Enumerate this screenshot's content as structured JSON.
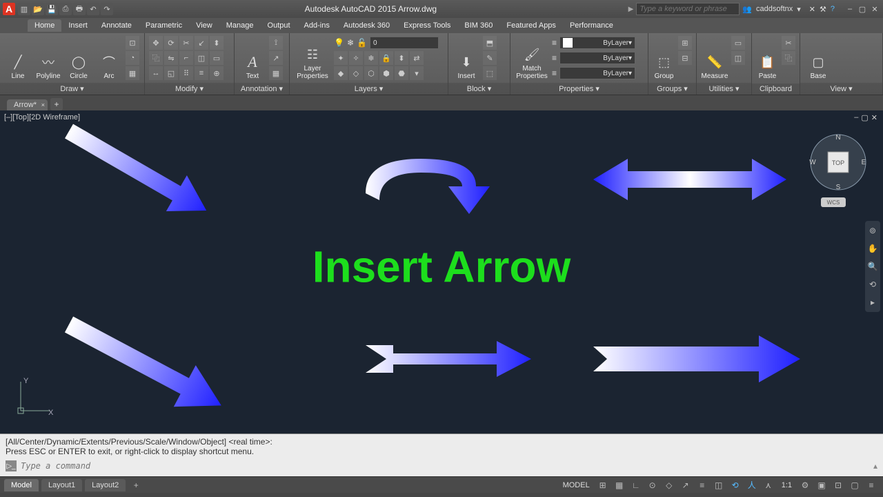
{
  "title": "Autodesk AutoCAD 2015   Arrow.dwg",
  "search": {
    "placeholder": "Type a keyword or phrase"
  },
  "user": "caddsoftnx",
  "tabs": [
    "Home",
    "Insert",
    "Annotate",
    "Parametric",
    "View",
    "Manage",
    "Output",
    "Add-ins",
    "Autodesk 360",
    "Express Tools",
    "BIM 360",
    "Featured Apps",
    "Performance"
  ],
  "active_tab": "Home",
  "ribbon": {
    "draw": {
      "title": "Draw ▾",
      "btns": [
        "Line",
        "Polyline",
        "Circle",
        "Arc"
      ]
    },
    "modify": {
      "title": "Modify ▾"
    },
    "annotation": {
      "title": "Annotation ▾",
      "text": "Text"
    },
    "layers": {
      "title": "Layers ▾",
      "lp": "Layer\nProperties",
      "field": "0"
    },
    "block": {
      "title": "Block ▾",
      "insert": "Insert"
    },
    "properties": {
      "title": "Properties ▾",
      "match": "Match\nProperties",
      "fields": [
        "ByLayer",
        "ByLayer",
        "ByLayer"
      ]
    },
    "groups": {
      "title": "Groups ▾",
      "group": "Group"
    },
    "utilities": {
      "title": "Utilities ▾",
      "measure": "Measure"
    },
    "clipboard": {
      "title": "Clipboard",
      "paste": "Paste"
    },
    "view": {
      "title": "View ▾",
      "base": "Base"
    }
  },
  "file_tab": "Arrow*",
  "viewport": "[–][Top][2D Wireframe]",
  "overlay": "Insert Arrow",
  "wcs": "WCS",
  "nav_top": "TOP",
  "ucs": {
    "y": "Y",
    "x": "X"
  },
  "cmd": {
    "line1": "[All/Center/Dynamic/Extents/Previous/Scale/Window/Object] <real time>:",
    "line2": "Press ESC or ENTER to exit, or right-click to display shortcut menu.",
    "placeholder": "Type a command"
  },
  "status": {
    "tabs": [
      "Model",
      "Layout1",
      "Layout2"
    ],
    "model": "MODEL",
    "scale": "1:1"
  }
}
